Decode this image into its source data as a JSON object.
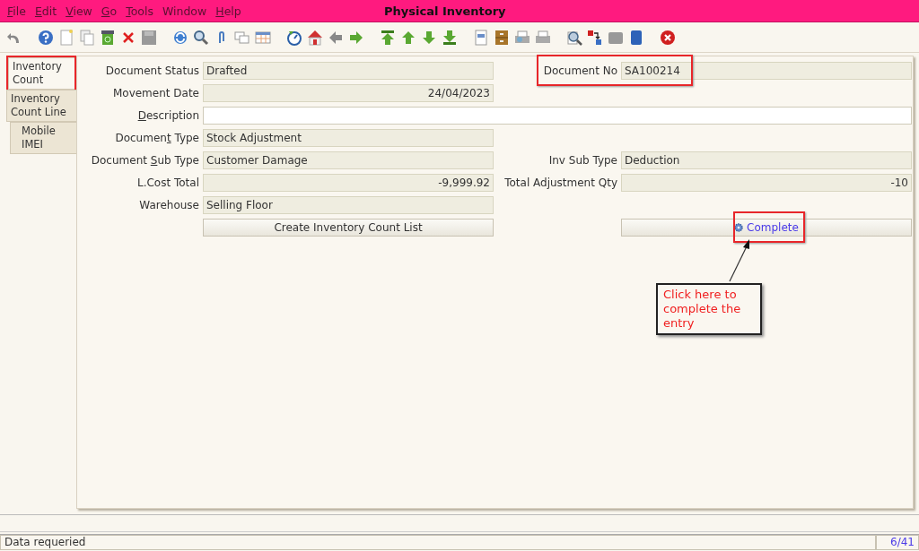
{
  "window": {
    "title": "Physical Inventory"
  },
  "menu": [
    {
      "key": "F",
      "after": "ile"
    },
    {
      "key": "E",
      "after": "dit"
    },
    {
      "key": "V",
      "after": "iew"
    },
    {
      "key": "G",
      "after": "o"
    },
    {
      "key": "T",
      "after": "ools"
    },
    {
      "before": "Window"
    },
    {
      "key": "H",
      "after": "elp"
    }
  ],
  "tabs": [
    {
      "label": "Inventory Count",
      "selected": true,
      "highlighted": true
    },
    {
      "label": "Inventory Count Line",
      "selected": false,
      "highlighted": false,
      "children": [
        {
          "label": "Mobile IMEI",
          "selected": false,
          "highlighted": false
        }
      ]
    }
  ],
  "form": {
    "rows": [
      {
        "fields": [
          {
            "label": {
              "before": "Document Status"
            },
            "value": "Drafted",
            "kind": "text",
            "editable": false,
            "highlighted": false
          },
          {
            "label": {
              "before": "Document No"
            },
            "value": "SA100214",
            "kind": "text",
            "editable": false,
            "highlighted": true
          }
        ]
      },
      {
        "fields": [
          {
            "label": {
              "before": "Movement Date"
            },
            "value": "24/04/2023",
            "kind": "number",
            "editable": false,
            "highlighted": false
          }
        ]
      },
      {
        "fields": [
          {
            "label": {
              "key": "D",
              "after": "escription"
            },
            "kind": "wide",
            "editable": true,
            "highlighted": false
          }
        ]
      },
      {
        "fields": [
          {
            "label": {
              "before": "Documen",
              "key": "t",
              "after": " Type"
            },
            "value": "Stock Adjustment",
            "kind": "text",
            "editable": false,
            "highlighted": false
          }
        ]
      },
      {
        "fields": [
          {
            "label": {
              "before": "Document ",
              "key": "S",
              "after": "ub Type"
            },
            "value": "Customer Damage",
            "kind": "text",
            "editable": false,
            "highlighted": false
          },
          {
            "label": {
              "before": "Inv Sub Type"
            },
            "value": "Deduction",
            "kind": "text",
            "editable": false,
            "highlighted": false
          }
        ]
      },
      {
        "fields": [
          {
            "label": {
              "before": "L.Cost Total"
            },
            "value": "-9,999.92",
            "kind": "number",
            "editable": false,
            "highlighted": false
          },
          {
            "label": {
              "before": "Total Adjustment Qty"
            },
            "value": "-10",
            "kind": "number",
            "editable": false,
            "highlighted": false
          }
        ]
      },
      {
        "fields": [
          {
            "label": {
              "before": "Warehouse"
            },
            "value": "Selling Floor",
            "kind": "text",
            "editable": false,
            "highlighted": false
          }
        ]
      }
    ],
    "buttons": [
      {
        "label": "Create Inventory Count List",
        "kind": "plain",
        "highlighted": false
      },
      {
        "label": "Complete",
        "kind": "process",
        "highlighted": true
      }
    ]
  },
  "callout": {
    "text": "Click here to complete the entry"
  },
  "status_bar": {
    "message": "Data requeried",
    "record": "6/41"
  }
}
